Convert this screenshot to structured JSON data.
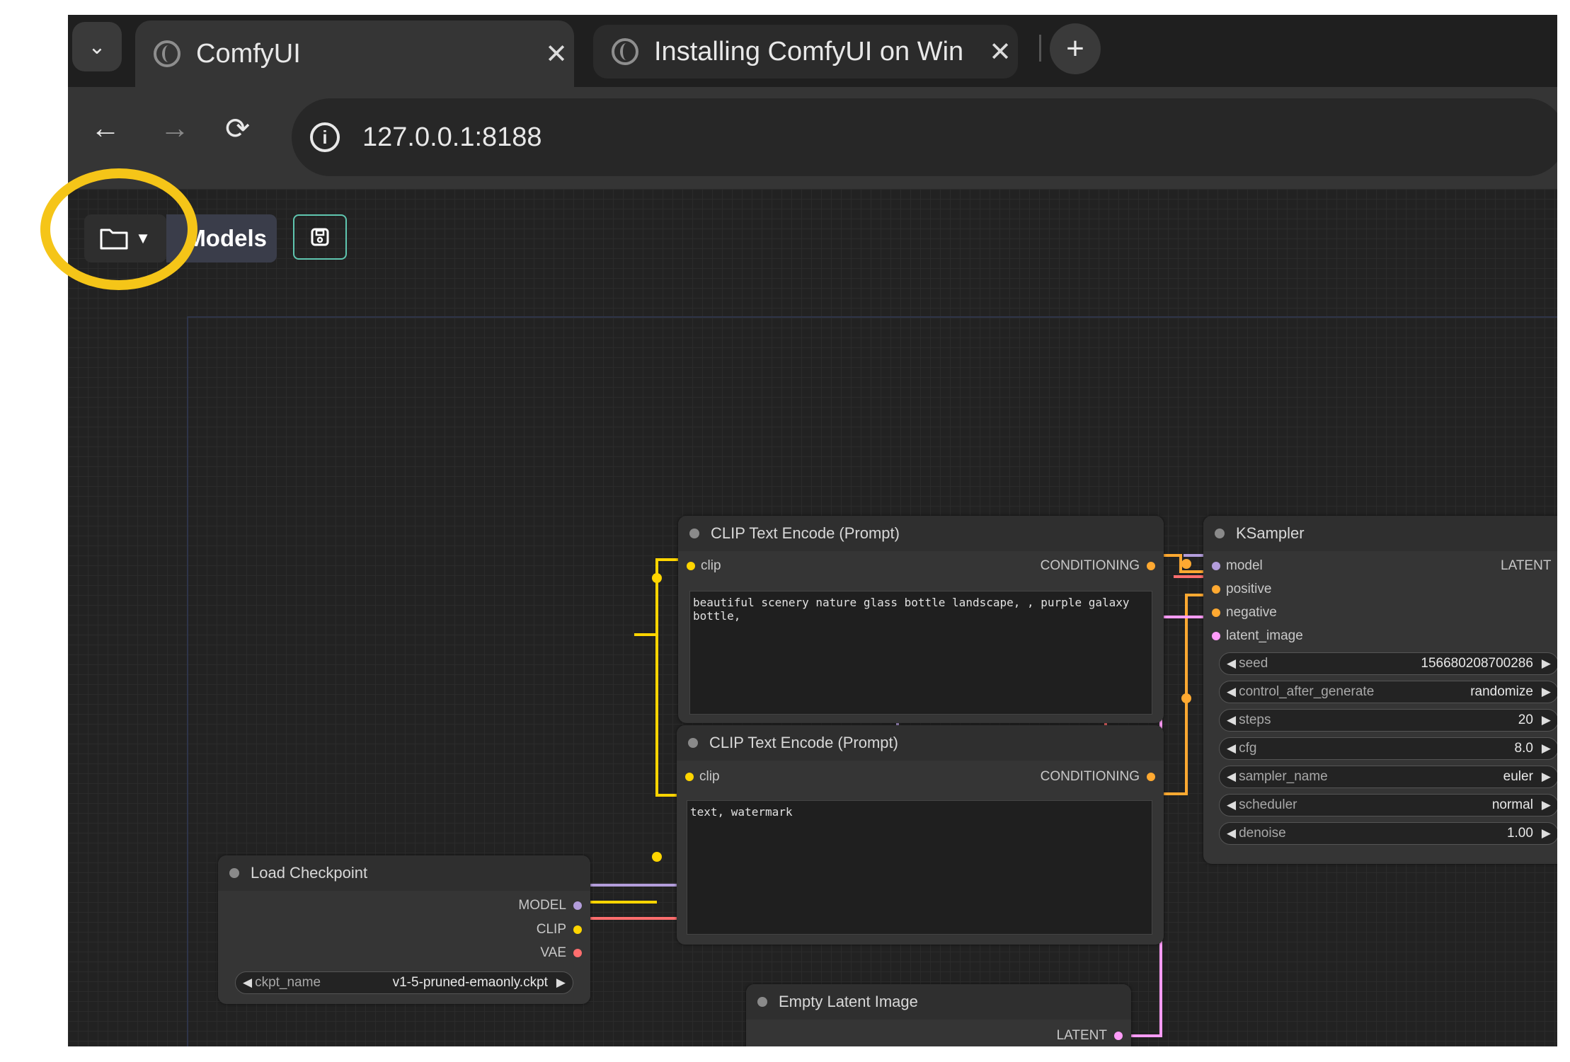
{
  "browser": {
    "tabs": [
      {
        "title": "ComfyUI",
        "active": true
      },
      {
        "title": "Installing ComfyUI on Win",
        "active": false
      }
    ],
    "tab_close": "✕",
    "new_tab": "+",
    "tab_menu": "⌄",
    "url": "127.0.0.1:8188",
    "back": "←",
    "forward": "→",
    "reload": "⟳"
  },
  "toolbar": {
    "workflow_caret": "▼",
    "models_label": "Models"
  },
  "nodes": {
    "clip_positive": {
      "title": "CLIP Text Encode (Prompt)",
      "input": "clip",
      "output": "CONDITIONING",
      "text": "beautiful scenery nature glass bottle landscape, , purple galaxy bottle,"
    },
    "clip_negative": {
      "title": "CLIP Text Encode (Prompt)",
      "input": "clip",
      "output": "CONDITIONING",
      "text": "text, watermark"
    },
    "ksampler": {
      "title": "KSampler",
      "inputs": [
        "model",
        "positive",
        "negative",
        "latent_image"
      ],
      "output": "LATENT",
      "widgets": [
        {
          "name": "seed",
          "value": "156680208700286"
        },
        {
          "name": "control_after_generate",
          "value": "randomize"
        },
        {
          "name": "steps",
          "value": "20"
        },
        {
          "name": "cfg",
          "value": "8.0"
        },
        {
          "name": "sampler_name",
          "value": "euler"
        },
        {
          "name": "scheduler",
          "value": "normal"
        },
        {
          "name": "denoise",
          "value": "1.00"
        }
      ]
    },
    "load_checkpoint": {
      "title": "Load Checkpoint",
      "outputs": [
        "MODEL",
        "CLIP",
        "VAE"
      ],
      "widget": {
        "name": "ckpt_name",
        "value": "v1-5-pruned-emaonly.ckpt"
      }
    },
    "empty_latent": {
      "title": "Empty Latent Image",
      "output": "LATENT"
    }
  },
  "colors": {
    "clip": "#ffd500",
    "conditioning": "#ffa931",
    "model": "#b39ddb",
    "vae": "#ff6e6e",
    "latent": "#ff9cf9",
    "highlight": "#f5c518",
    "save_accent": "#5fc6b0"
  }
}
